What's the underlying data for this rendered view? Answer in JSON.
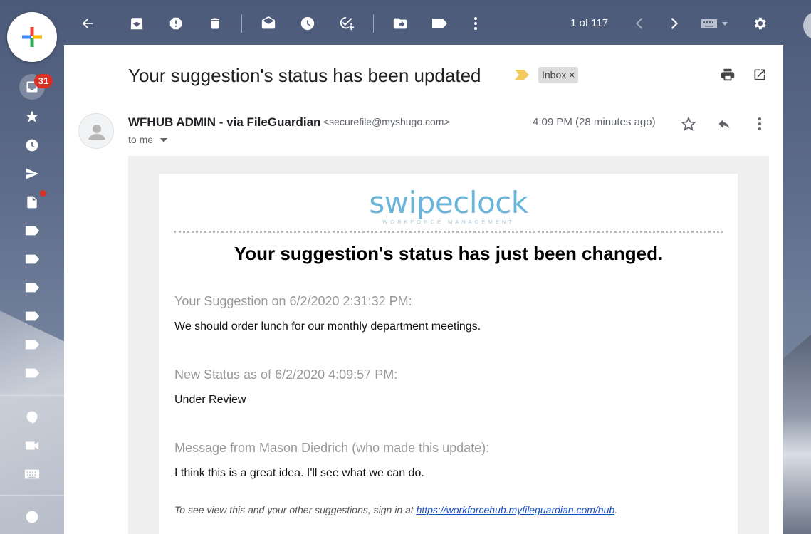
{
  "rail": {
    "inbox_badge": "31",
    "items": [
      "inbox-icon",
      "star-icon",
      "clock-icon",
      "send-icon",
      "draft-icon",
      "label-icon",
      "label-icon",
      "label-icon",
      "label-icon",
      "label-icon",
      "label-icon",
      "hangouts-icon",
      "video-icon",
      "keyboard-icon",
      "quote-icon"
    ]
  },
  "toolbar": {
    "counter": "1 of 117",
    "icons": [
      "back-arrow-icon",
      "archive-icon",
      "report-spam-icon",
      "delete-icon",
      "mark-unread-icon",
      "snooze-icon",
      "add-task-icon",
      "move-to-icon",
      "labels-icon",
      "more-vert-icon",
      "prev-icon",
      "next-icon",
      "keyboard-icon",
      "settings-icon"
    ]
  },
  "email": {
    "subject": "Your suggestion's status has been updated",
    "label_chip": "Inbox",
    "label_chip_close": "×",
    "sender_name": "WFHUB ADMIN - via FileGuardian",
    "sender_email": "<securefile@myshugo.com>",
    "to": "to me",
    "time": "4:09 PM (28 minutes ago)"
  },
  "body": {
    "logo": "swipeclock",
    "logo_sub": "WORKFORCE MANAGEMENT",
    "headline": "Your suggestion's status has just been changed.",
    "sections": [
      {
        "label": "Your Suggestion on 6/2/2020 2:31:32 PM:",
        "value": "We should order lunch for our monthly department meetings."
      },
      {
        "label": "New Status as of 6/2/2020 4:09:57 PM:",
        "value": "Under Review"
      },
      {
        "label": "Message from Mason Diedrich (who made this update):",
        "value": "I think this is a great idea. I'll see what we can do."
      }
    ],
    "footer_prefix": "To see view this and your other suggestions, sign in at ",
    "footer_link": "https://workforcehub.myfileguardian.com/hub",
    "footer_suffix": "."
  },
  "colors": {
    "badge": "#d93025",
    "logo": "#6bb5db",
    "link": "#1a4fc4",
    "importance": "#f4c95d"
  }
}
